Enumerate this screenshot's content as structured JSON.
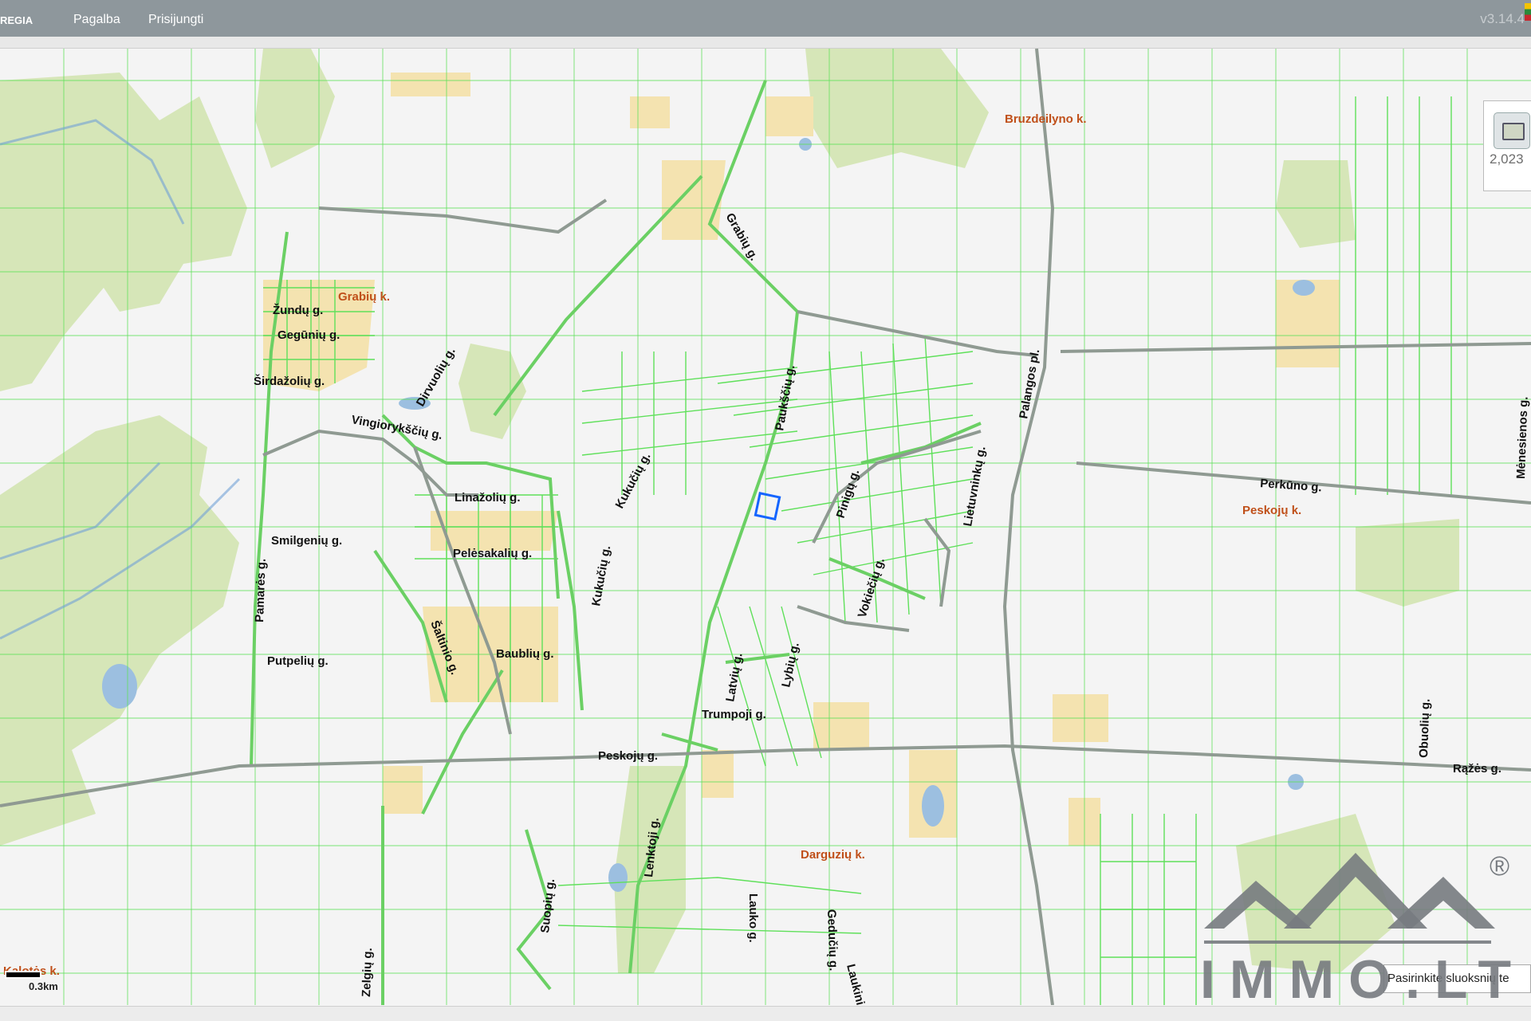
{
  "header": {
    "brand": "REGIA",
    "menu": [
      "Pagalba",
      "Prisijungti"
    ],
    "version": "v3.14.4"
  },
  "map": {
    "scale_value": "2,023",
    "scale_bar_label": "0.3km",
    "layer_select_text": "Pasirinkite sluoksnių te",
    "streets": [
      "Žundų g.",
      "Gegūnių g.",
      "Širdažolių g.",
      "Dirvuolių g.",
      "Vingiorykščių g.",
      "Linažolių g.",
      "Smilgenių g.",
      "Pelėsakalių g.",
      "Pamarės g.",
      "Putpelių g.",
      "Šaltinio g.",
      "Baublių g.",
      "Kukučių g.",
      "Kukučių g.",
      "Grabių g.",
      "Paukščių g.",
      "Pinigų g.",
      "Lietuvninkų g.",
      "Vokiečių g.",
      "Latvių g.",
      "Lybių g.",
      "Trumpoji g.",
      "Palangos pl.",
      "Perkūno g.",
      "Peskojų g.",
      "Lenktoji g.",
      "Suopių g.",
      "Zelgių g.",
      "Gedučių g.",
      "Laukininkų g.",
      "Lauko g.",
      "Rąžės g.",
      "Obuolių g.",
      "Mėnesienos g."
    ],
    "villages": [
      "Bruzdeilyno k.",
      "Grabių k.",
      "Peskojų k.",
      "Darguzių k.",
      "Kalotės k."
    ],
    "colors": {
      "parcel": "#5fe05a",
      "road": "#8f9a92",
      "forest": "#d6e6b8",
      "building_area": "#f4e3b0",
      "water": "#9cbfe0",
      "selected": "#1565ff"
    }
  },
  "logo": {
    "text": "IMMO.LT",
    "mark": "®"
  }
}
